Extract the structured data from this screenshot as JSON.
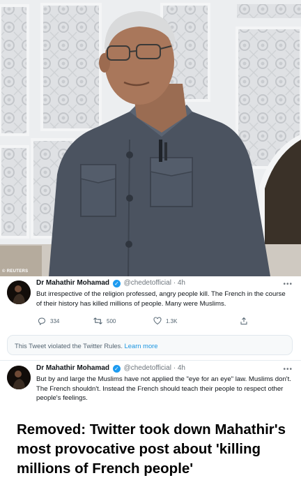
{
  "photo": {
    "credit": "© REUTERS",
    "subject": "photograph"
  },
  "tweet1": {
    "name": "Dr Mahathir Mohamad",
    "handle": "@chedetofficial",
    "dot": "·",
    "time": "4h",
    "text": "But irrespective of the religion professed, angry people kill. The French in the course of their history has killed millions of people. Many were Muslims.",
    "reply_count": "334",
    "retweet_count": "500",
    "like_count": "1.3K"
  },
  "violation": {
    "text": "This Tweet violated the Twitter Rules.",
    "link": "Learn more"
  },
  "tweet2": {
    "name": "Dr Mahathir Mohamad",
    "handle": "@chedetofficial",
    "dot": "·",
    "time": "4h",
    "text": "But by and large the Muslims have not applied the \"eye for an eye\" law. Muslims don't. The French shouldn't. Instead the French should teach their people to respect other people's feelings."
  },
  "caption": "Removed: Twitter took down Mahathir's most provocative post about 'killing millions of French people'",
  "colors": {
    "twitter_blue": "#1d9bf0",
    "link_blue": "#1b95e0",
    "text_dark": "#0f1419",
    "text_gray": "#536471"
  },
  "icons": [
    "verified-icon",
    "more-icon",
    "reply-icon",
    "retweet-icon",
    "like-icon",
    "share-icon"
  ]
}
